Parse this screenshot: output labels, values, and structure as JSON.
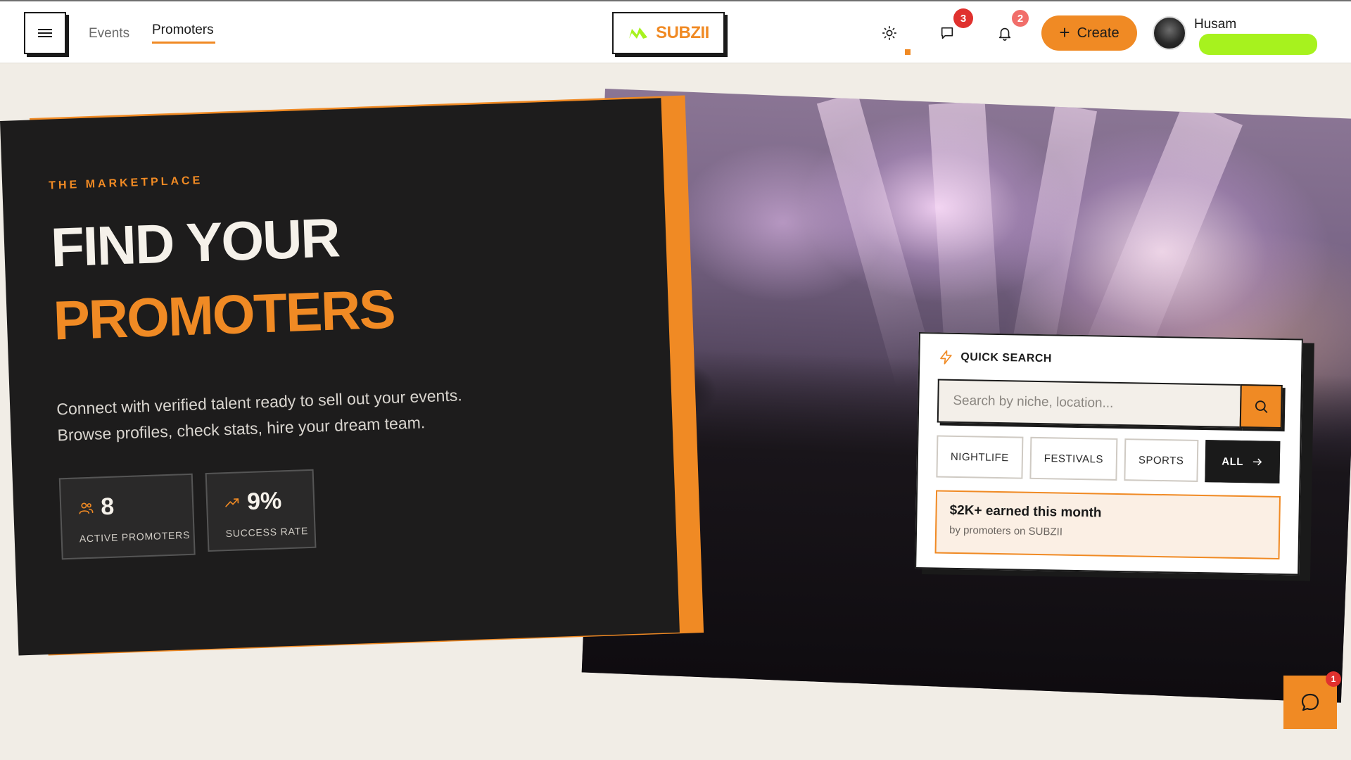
{
  "header": {
    "nav": {
      "events": "Events",
      "promoters": "Promoters"
    },
    "logo_text": "SUBZII",
    "badges": {
      "messages": "3",
      "notifications": "2"
    },
    "create_label": "Create",
    "user_name": "Husam"
  },
  "hero": {
    "eyebrow": "THE MARKETPLACE",
    "headline_line1": "FIND YOUR",
    "headline_line2": "PROMOTERS",
    "description": "Connect with verified talent ready to sell out your events. Browse profiles, check stats, hire your dream team.",
    "stats": [
      {
        "value": "8",
        "label": "ACTIVE PROMOTERS",
        "icon": "users-icon"
      },
      {
        "value": "9%",
        "label": "SUCCESS RATE",
        "icon": "trending-up-icon"
      }
    ]
  },
  "quick_search": {
    "title": "QUICK SEARCH",
    "placeholder": "Search by niche, location...",
    "chips": [
      "NIGHTLIFE",
      "FESTIVALS",
      "SPORTS"
    ],
    "all_label": "ALL",
    "promo_title": "$2K+ earned this month",
    "promo_sub": "by promoters on SUBZII"
  },
  "floating_chat": {
    "badge": "1"
  },
  "colors": {
    "accent": "#f08a24",
    "dark": "#1d1c1c",
    "lime": "#a7f21e",
    "badge_red": "#e0312e"
  }
}
